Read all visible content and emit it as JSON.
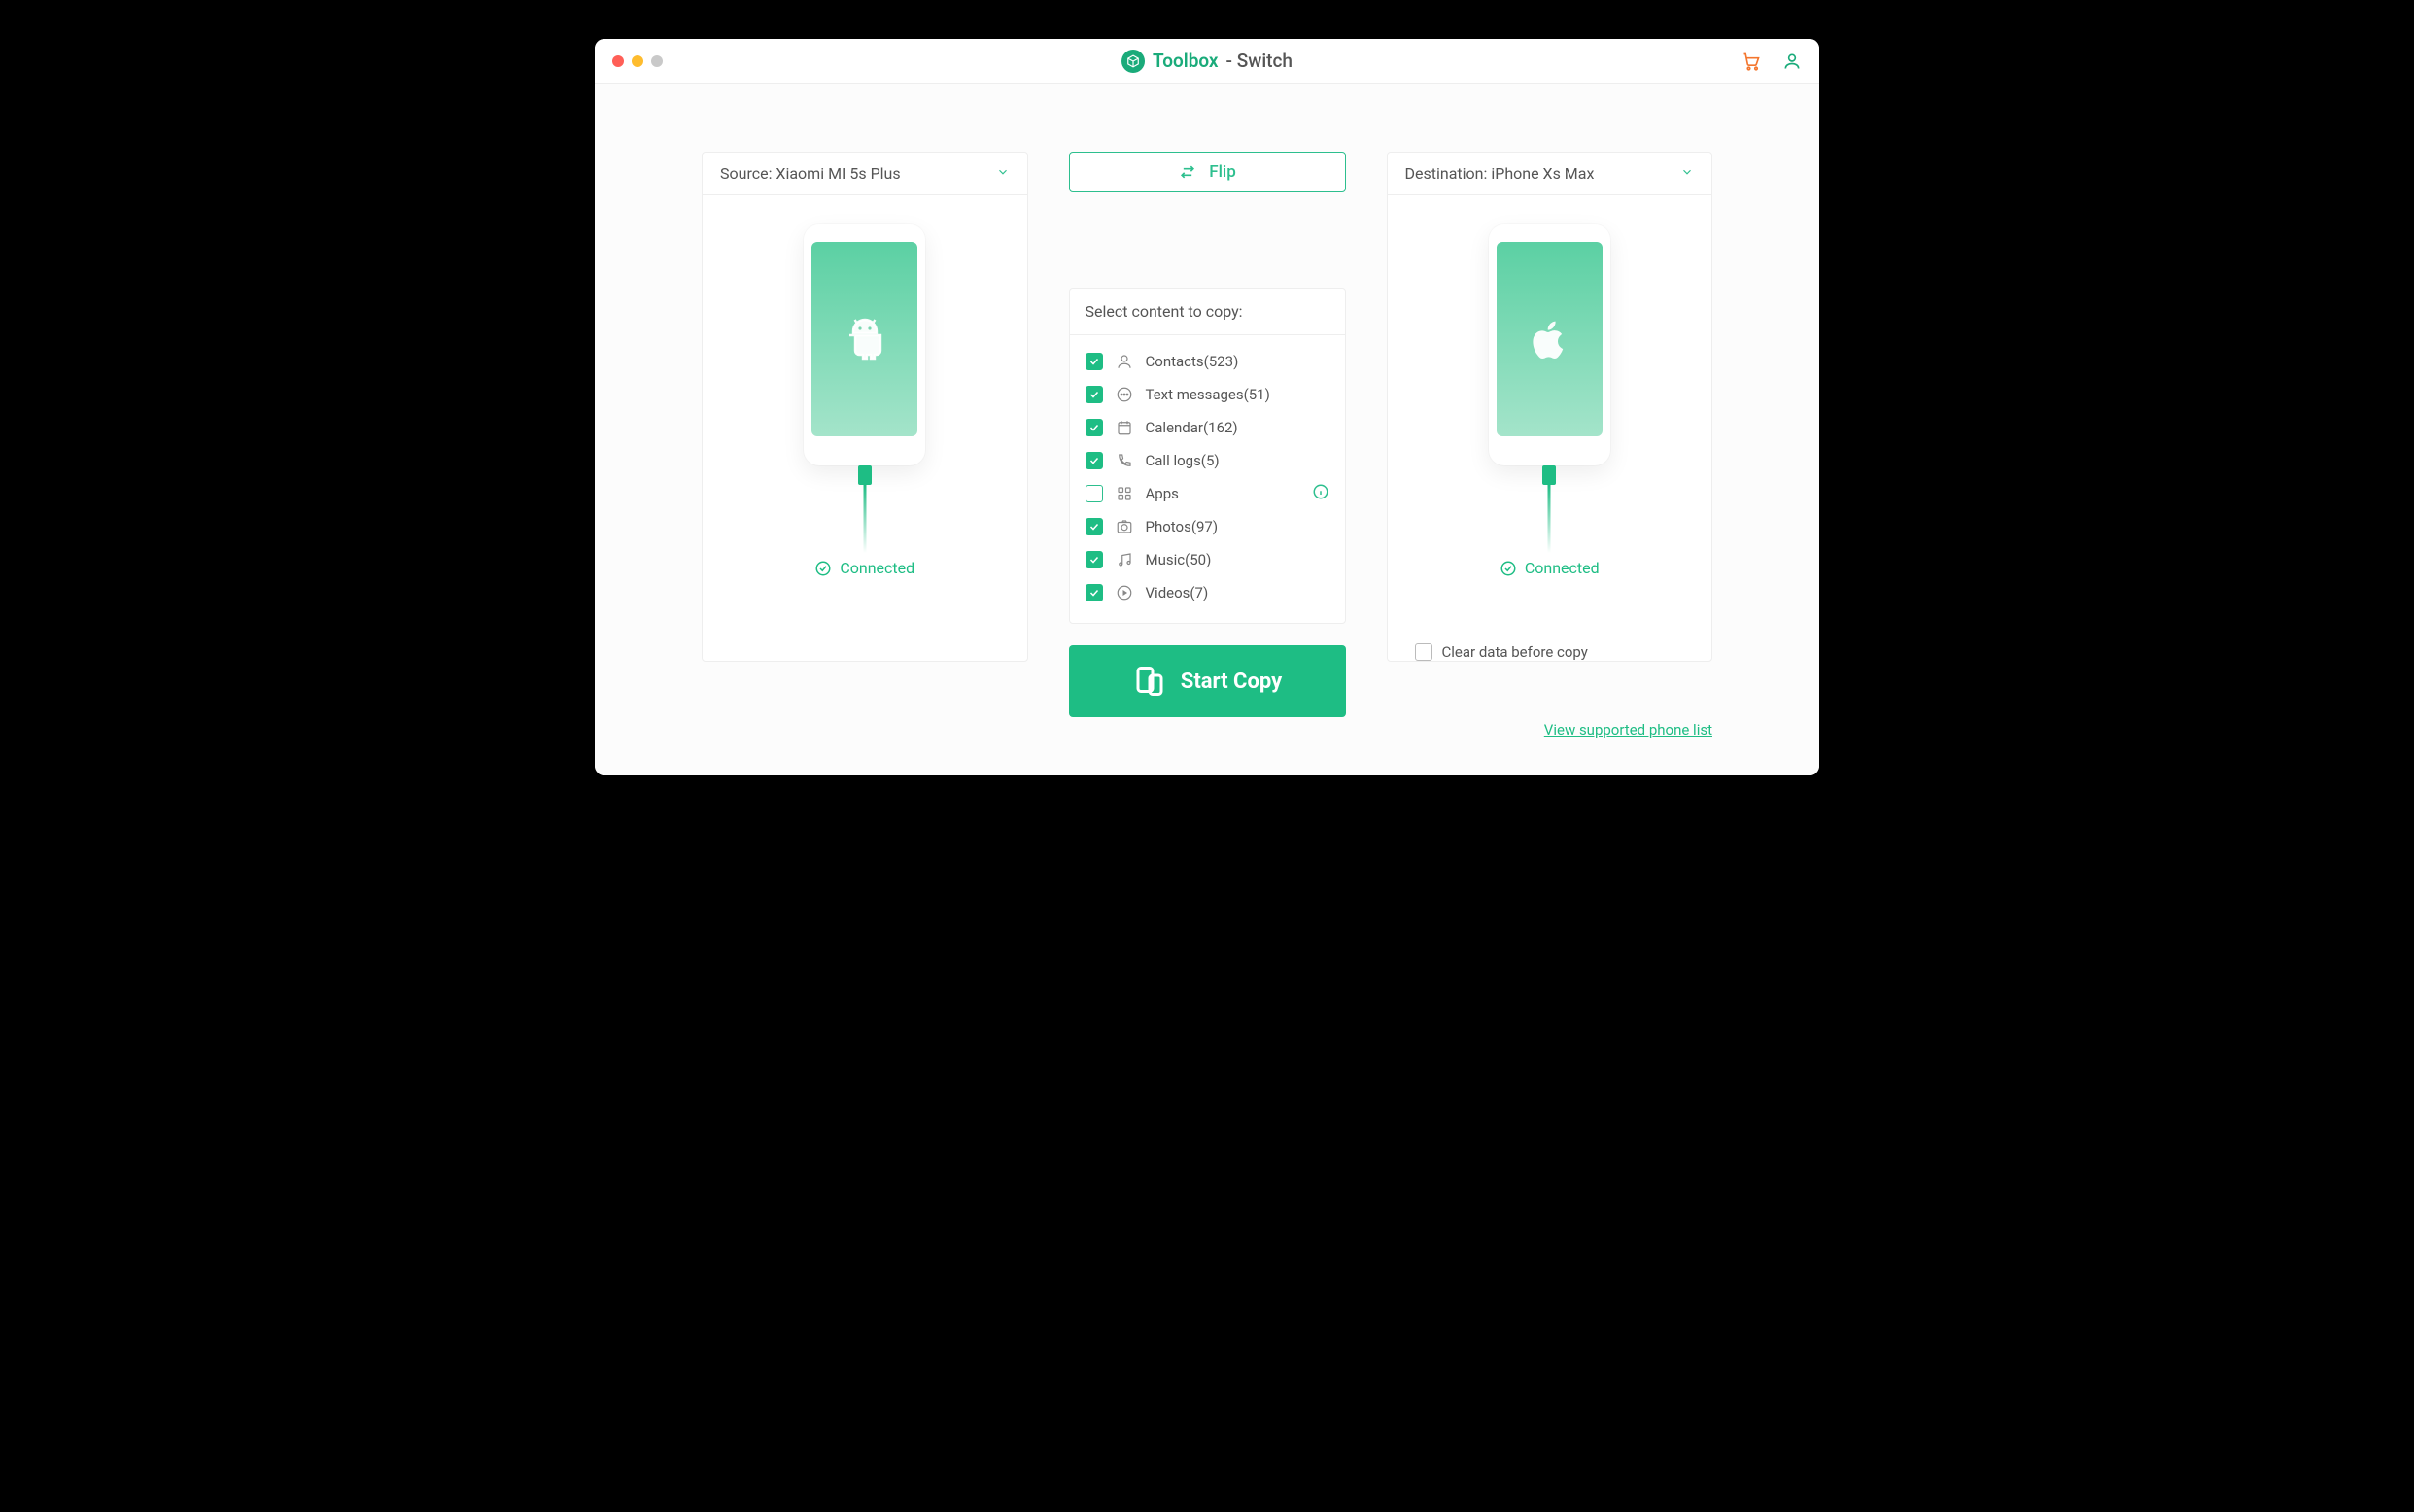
{
  "app": {
    "name": "Toolbox",
    "module": "- Switch"
  },
  "source": {
    "label": "Source: Xiaomi MI 5s Plus",
    "status": "Connected",
    "platform": "android"
  },
  "destination": {
    "label": "Destination: iPhone Xs Max",
    "status": "Connected",
    "platform": "ios"
  },
  "mid": {
    "flip_label": "Flip",
    "select_title": "Select content to copy:",
    "start_label": "Start Copy"
  },
  "items": [
    {
      "name": "Contacts(523)",
      "checked": true,
      "icon": "contacts",
      "info": false
    },
    {
      "name": "Text messages(51)",
      "checked": true,
      "icon": "messages",
      "info": false
    },
    {
      "name": "Calendar(162)",
      "checked": true,
      "icon": "calendar",
      "info": false
    },
    {
      "name": "Call logs(5)",
      "checked": true,
      "icon": "calllogs",
      "info": false
    },
    {
      "name": "Apps",
      "checked": false,
      "icon": "apps",
      "info": true
    },
    {
      "name": "Photos(97)",
      "checked": true,
      "icon": "photos",
      "info": false
    },
    {
      "name": "Music(50)",
      "checked": true,
      "icon": "music",
      "info": false
    },
    {
      "name": "Videos(7)",
      "checked": true,
      "icon": "videos",
      "info": false
    }
  ],
  "dest_options": {
    "clear_label": "Clear data before copy",
    "clear_checked": false
  },
  "links": {
    "support": "View supported phone list"
  }
}
